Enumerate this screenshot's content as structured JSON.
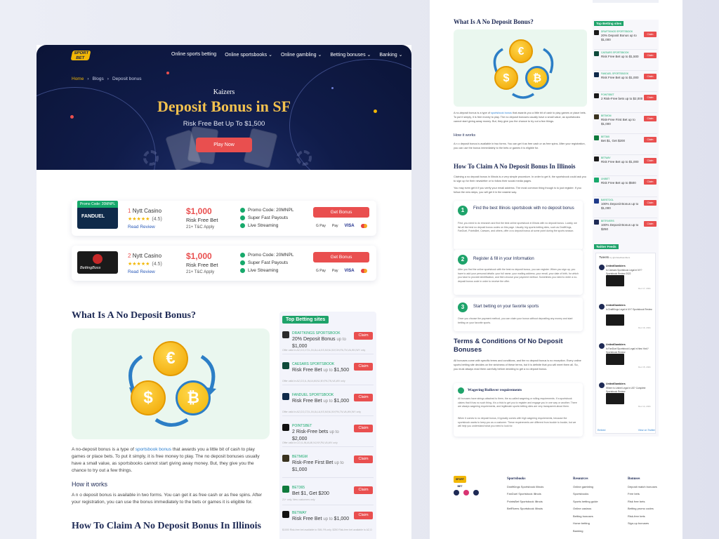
{
  "nav": {
    "logo": "SPORT BET",
    "items": [
      "Online sports betting",
      "Online sportsbooks",
      "Online gambling",
      "Betting bonuses",
      "Banking"
    ]
  },
  "breadcrumb": [
    "Home",
    "Blogs",
    "Deposit bonus"
  ],
  "hero": {
    "kicker": "Kaizers",
    "title": "Deposit Bonus in SF",
    "subtitle": "Risk Free Bet Up To $1,500",
    "cta": "Play Now"
  },
  "casinos": [
    {
      "promo": "Promo Code: 20MNPL",
      "logo": "FANDUEL",
      "rank": "1",
      "name": "Nytt Casino",
      "stars": "★★★★★",
      "rating": "(4.5)",
      "review": "Read Review",
      "amount": "$1,000",
      "offer": "Risk Free Bet",
      "terms": "21+ T&C Apply",
      "features": [
        "Promo Code: 20MNPL",
        "Super Fast Payouts",
        "Live Streaming"
      ],
      "cta": "Get Bonus"
    },
    {
      "promo": "",
      "logo": "BettingBoss",
      "rank": "2",
      "name": "Nytt Casino",
      "stars": "★★★★★",
      "rating": "(4.5)",
      "review": "Read Review",
      "amount": "$1,000",
      "offer": "Risk Free Bet",
      "terms": "21+ T&C Apply",
      "features": [
        "Promo Code: 20MNPL",
        "Super Fast Payouts",
        "Live Streaming"
      ],
      "cta": "Get Bonus"
    }
  ],
  "payments": [
    "G Pay",
    "Pay",
    "VISA"
  ],
  "article": {
    "h2": "What Is A No Deposit Bonus?",
    "p1_a": "A no-deposit bonus is a type of ",
    "p1_link": "sportsbook bonus",
    "p1_b": " that awards you a little bit of cash to play games or place bets. To put it simply, it is free money to play. The no deposit bonuses usually have a small value, as sportsbooks cannot start giving away money. But, they give you the chance to try out a few things.",
    "h3": "How it works",
    "p2": "A n o deposit bonus is available in two forms. You can get it as free cash or as free spins. After your registration, you can use the bonus immediately to the bets or games it is eligible for.",
    "h2b": "How To Claim A No Deposit Bonus In Illinois"
  },
  "sidebar": {
    "title": "Top Betting sites",
    "claim": "Claim",
    "items": [
      {
        "name": "DRAFTKINGS SPORTSBOOK",
        "offer": "20% Deposit Bonus",
        "upto": "up to",
        "amount": "$1,000",
        "fine": "Offer valid in AZ,CO,CT,IL,IN,IA,LA,KS,MI,NJ,NY,OH,PA,TN,VA,WV,WY only"
      },
      {
        "name": "CAESARS SPORTSBOOK",
        "offer": "Risk Free Bet",
        "upto": "up to",
        "amount": "$1,500",
        "fine": "Offer valid in AZ,CO,IL,IN,IA,MI,NJ,NY,PA,TN,VA,WV only"
      },
      {
        "name": "FANDUEL SPORTSBOOK",
        "offer": "Risk Free Bet",
        "upto": "up to",
        "amount": "$1,000",
        "fine": "Offer valid in AZ,CO,CT,IL,IN,IA,LA,KS,MI,NJ,NY,PA,TN,VA,WV,WY only"
      },
      {
        "name": "POINTSBET",
        "offer": "2 Risk-Free bets",
        "upto": "up to",
        "amount": "$2,000",
        "fine": "Offer valid in CO,IL,IN,IA,MI,NJ,NY,PA,VA,WV only"
      },
      {
        "name": "BETMGM",
        "offer": "Risk-Free First Bet",
        "upto": "up to",
        "amount": "$1,000",
        "fine": ""
      },
      {
        "name": "BET365",
        "offer": "Bet $1, Get $200",
        "upto": "",
        "amount": "",
        "fine": "21+ only. New customers only"
      },
      {
        "name": "BETWAY",
        "offer": "Risk Free Bet",
        "upto": "up to",
        "amount": "$1,000",
        "fine": "$1000 Risk-free bet available to SML PA only. $250 Risk-free bet available to AZ,CO,IN,IA"
      }
    ]
  },
  "right": {
    "h2": "What Is A No Deposit Bonus?",
    "p1_a": "A no-deposit bonus is a type of ",
    "p1_link": "sportsbook bonus",
    "p1_b": " that awards you a little bit of cash to play games or place bets. To put it simply, it is free money to play. The no deposit bonuses usually have a small value, as sportsbooks cannot start giving away money. But, they give you the chance to try out a few things.",
    "h3": "How it works",
    "p2": "A n o deposit bonus is available in two forms. You can get it as free cash or as free spins. After your registration, you can use the bonus immediately to the bets or games it is eligible for.",
    "h2b": "How To Claim A No Deposit Bonus In Illinois",
    "p3": "Claiming a no deposit bonus in Illinois is a very simple procedure. In order to get it, the sportsbook could ask you to sign up for their newsletter or to follow their social media pages.",
    "p4": "You may even get it if you verify your email address. The most common thing though is to just register. If you follow the new steps, you will get it in the easiest way.",
    "steps": [
      {
        "num": "1",
        "title": "Find the best Illinois sportsbook with no deposit bonus",
        "text": "First, you need to do research and find the best online sportsbook in Illinois with no deposit bonus. Luckily, we list all the best no deposit bonus codes on this page. Usually, big sports betting sites, such as DraftKings, FanDuel, PointsBet, Caesars, and others, offer a no deposit bonus at some point during the sports season."
      },
      {
        "num": "2",
        "title": "Register & fill in your Information",
        "text": "After you find the online sportsbook with the best no deposit bonus, you can register. When you sign up, you have to add your personal details: your full name, your mailing address, your email, your date of birth, for which you have to provide identification, and then choose your payment method. Sometimes you need to enter a no-deposit bonus code in order to receive the offer."
      },
      {
        "num": "3",
        "title": "Start betting on your favorite sports",
        "text": "Once you choose the payment method, you can claim your bonus without depositing any money and start betting on your favorite sports."
      }
    ],
    "tc_title": "Terms & Conditions Of No Deposit Bonuses",
    "tc_text": "All bonuses come with specific terms and conditions, and the no deposit bonus is no exception. Every online sports betting site decides on the strictness of these terms, but it is definite that you will meet them all. So, you must always read them carefully before deciding to get a no deposit bonus.",
    "wr_title": "Wagering/Rollover requirements",
    "wr_text1": "All bonuses have strings attached to them, the so-called wagering or rolling requirements. If a sportsbook claims that it has no such thing, it is a trick to get you to register and engage you in one way or another. There are always wagering requirements, and legitimate sports betting sites are very transparent about them.",
    "wr_text2": "When it comes to no deposit bonus, it typically comes with high wagering requirements, because the sportsbook wants to keep you as a customer. These requirements are different from bookie to bookie, but we will help you understand what you need to look for.",
    "side_title": "Top Betting sites",
    "side_claim": "Claim",
    "side_items": [
      {
        "name": "DRAFTKINGS SPORTSBOOK",
        "offer": "20% Deposit Bonus up to $1,000"
      },
      {
        "name": "CAESARS SPORTSBOOK",
        "offer": "Risk Free Bet up to $1,500"
      },
      {
        "name": "FANDUEL SPORTSBOOK",
        "offer": "Risk Free Bet up to $1,000"
      },
      {
        "name": "POINTSBET",
        "offer": "2 Risk-Free bets up to $2,000"
      },
      {
        "name": "BETMGM",
        "offer": "Risk-Free First Bet up to $1,000"
      },
      {
        "name": "BET365",
        "offer": "Bet $1, Get $200"
      },
      {
        "name": "BETWAY",
        "offer": "Risk Free Bet up to $1,000"
      },
      {
        "name": "UNIBET",
        "offer": "Risk Free Bet up to $500"
      },
      {
        "name": "BARSTOOL",
        "offer": "100% Deposit Bonus up to $1,000"
      },
      {
        "name": "BETRIVERS",
        "offer": "100% Deposit Bonus up to $250"
      }
    ],
    "twitter_title": "Twitter Feeds",
    "twitter_head": "Tweets",
    "twitter_by": "by @UnitedGamblers",
    "tweets": [
      {
        "name": "UnitedGamblers",
        "text": "Is Caesars Sportsbook Legal in NY? Sportsbook Review 2022",
        "date": "Dec 17, 2021"
      },
      {
        "name": "UnitedGamblers",
        "text": "Is DraftKings Legal in NY? Sportsbook Review",
        "date": "Dec 16, 2021"
      },
      {
        "name": "UnitedGamblers",
        "text": "Is FanDuel Sportsbook Legal in New York? Sportsbook Review",
        "date": "Dec 15, 2021"
      },
      {
        "name": "UnitedGamblers",
        "text": "Where is Unibet Legal in US? Complete Sportsbook Review",
        "date": "Dec 14, 2021"
      }
    ],
    "twitter_embed": "Embed",
    "twitter_view": "View on Twitter",
    "footer": {
      "sportsbooks_title": "Sportsbooks",
      "sportsbooks": [
        "DraftKings Sportsbook Illinois",
        "FanDuel Sportsbook Illinois",
        "PointsBet Sportsbook Illinois",
        "BetRivers Sportsbook Illinois"
      ],
      "resources_title": "Resources",
      "resources": [
        "Online gambling",
        "Sportsbooks",
        "Sports betting guide",
        "Online casinos",
        "Betting bonuses",
        "Horse betting",
        "Banking"
      ],
      "bonuses_title": "Bonuses",
      "bonuses": [
        "Deposit match bonuses",
        "Free bets",
        "Risk free bets",
        "Betting promo codes",
        "Risk-free bets",
        "Sign-up bonuses"
      ]
    }
  }
}
